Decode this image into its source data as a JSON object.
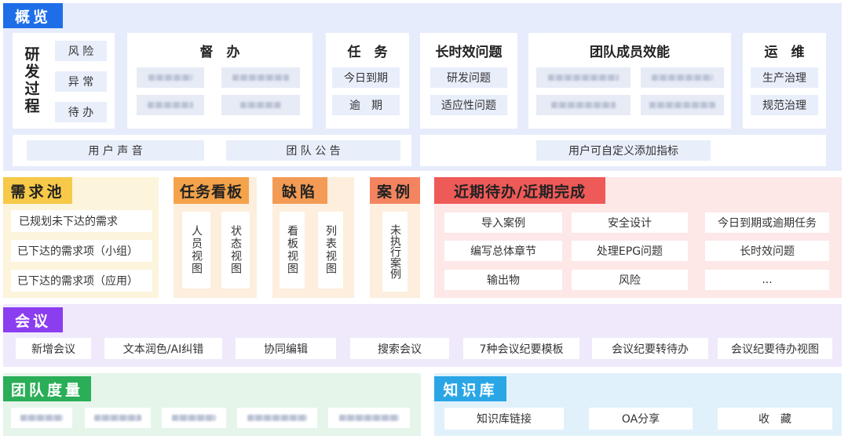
{
  "overview": {
    "tag": "概览",
    "rd_process": {
      "title": "研发过程",
      "items": [
        "风 险",
        "异 常",
        "待 办"
      ]
    },
    "supervise": {
      "title": "督　办"
    },
    "task": {
      "title": "任　务",
      "items": [
        "今日到期",
        "逾　期"
      ]
    },
    "long_issue": {
      "title": "长时效问题",
      "items": [
        "研发问题",
        "适应性问题"
      ]
    },
    "team_efficiency": {
      "title": "团队成员效能"
    },
    "ops": {
      "title": "运　维",
      "items": [
        "生产治理",
        "规范治理"
      ]
    },
    "bottom": {
      "user_voice": "用 户 声 音",
      "team_notice": "团 队 公 告",
      "custom_metric": "用户可自定义添加指标"
    }
  },
  "demand_pool": {
    "tag": "需求池",
    "items": [
      "已规划未下达的需求",
      "已下达的需求项（小组）",
      "已下达的需求项（应用）"
    ]
  },
  "task_board": {
    "tag": "任务看板",
    "items": [
      "人员视图",
      "状态视图"
    ]
  },
  "defect": {
    "tag": "缺陷",
    "items": [
      "看板视图",
      "列表视图"
    ]
  },
  "case": {
    "tag": "案例",
    "items": [
      "未执行案例"
    ]
  },
  "recent": {
    "tag": "近期待办/近期完成",
    "items": [
      "导入案例",
      "安全设计",
      "今日到期或逾期任务",
      "编写总体章节",
      "处理EPG问题",
      "长时效问题",
      "输出物",
      "风险",
      "..."
    ]
  },
  "meeting": {
    "tag": "会议",
    "items": [
      "新增会议",
      "文本润色/AI纠错",
      "协同编辑",
      "搜索会议",
      "7种会议纪要模板",
      "会议纪要转待办",
      "会议纪要待办视图"
    ]
  },
  "team_metric": {
    "tag": "团队度量"
  },
  "knowledge": {
    "tag": "知识库",
    "items": [
      "知识库链接",
      "OA分享",
      "收　藏"
    ]
  },
  "colors": {
    "overview_bg": "#e6ecfb",
    "overview_tag": "#1e6ee8",
    "demand_bg": "#fdf4dc",
    "demand_tag": "#f7c948",
    "board_bg": "#fdeedd",
    "board_tag": "#f4a34a",
    "defect_tag": "#f39b54",
    "case_tag": "#f4845f",
    "recent_bg": "#fde8e7",
    "recent_tag": "#ee5a57",
    "meeting_bg": "#efe9fb",
    "meeting_tag": "#8a3ef0",
    "metric_bg": "#e5f5ea",
    "metric_tag": "#2aae57",
    "knowledge_bg": "#e0f1fb",
    "knowledge_tag": "#2aa6e6"
  }
}
